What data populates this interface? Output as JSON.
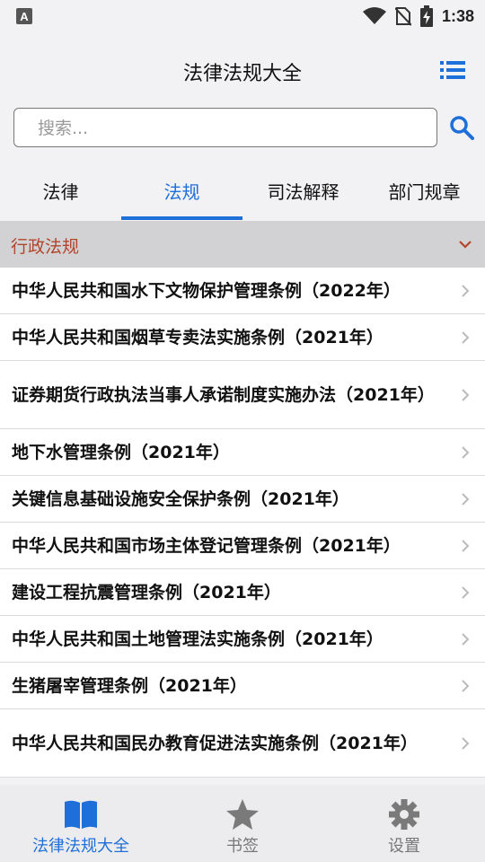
{
  "status": {
    "time": "1:38"
  },
  "header": {
    "title": "法律法规大全"
  },
  "search": {
    "placeholder": "搜索...",
    "value": ""
  },
  "tabs": [
    {
      "label": "法律",
      "active": false
    },
    {
      "label": "法规",
      "active": true
    },
    {
      "label": "司法解释",
      "active": false
    },
    {
      "label": "部门规章",
      "active": false
    }
  ],
  "section": {
    "title": "行政法规"
  },
  "items": [
    "中华人民共和国水下文物保护管理条例（2022年）",
    "中华人民共和国烟草专卖法实施条例（2021年）",
    "证券期货行政执法当事人承诺制度实施办法（2021年）",
    "地下水管理条例（2021年）",
    "关键信息基础设施安全保护条例（2021年）",
    "中华人民共和国市场主体登记管理条例（2021年）",
    "建设工程抗震管理条例（2021年）",
    "中华人民共和国土地管理法实施条例（2021年）",
    "生猪屠宰管理条例（2021年）",
    "中华人民共和国民办教育促进法实施条例（2021年）"
  ],
  "bottom_nav": [
    {
      "label": "法律法规大全",
      "icon": "book-icon",
      "active": true
    },
    {
      "label": "书签",
      "icon": "star-icon",
      "active": false
    },
    {
      "label": "设置",
      "icon": "gear-icon",
      "active": false
    }
  ],
  "colors": {
    "accent": "#1e6fd9",
    "section_text": "#b1452b",
    "section_bg": "#d2d2d5"
  }
}
